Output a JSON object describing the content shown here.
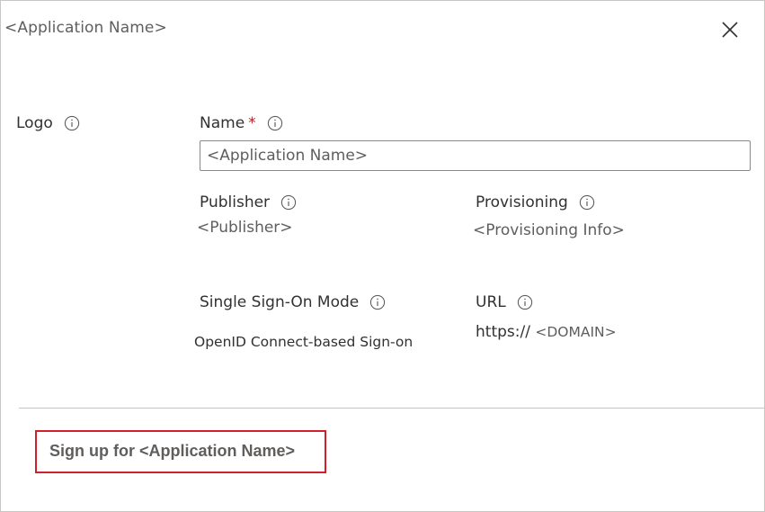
{
  "header": {
    "title": "<Application Name>",
    "close_icon": "close-icon"
  },
  "logo": {
    "label": "Logo",
    "info_icon": "info-icon"
  },
  "name": {
    "label": "Name",
    "required_mark": "*",
    "value": "<Application Name>",
    "info_icon": "info-icon"
  },
  "publisher": {
    "label": "Publisher",
    "value": "<Publisher>"
  },
  "provisioning": {
    "label": "Provisioning",
    "value": "<Provisioning Info>"
  },
  "sso": {
    "label": "Single Sign-On Mode",
    "value": "OpenID Connect-based Sign-on"
  },
  "url": {
    "label": "URL",
    "prefix": "https://",
    "domain": "<DOMAIN>"
  },
  "footer": {
    "signup_label": "Sign up for <Application Name>"
  },
  "colors": {
    "required": "#a4262c",
    "highlight_border": "#d0202e",
    "secondary_text": "#605e5c"
  }
}
